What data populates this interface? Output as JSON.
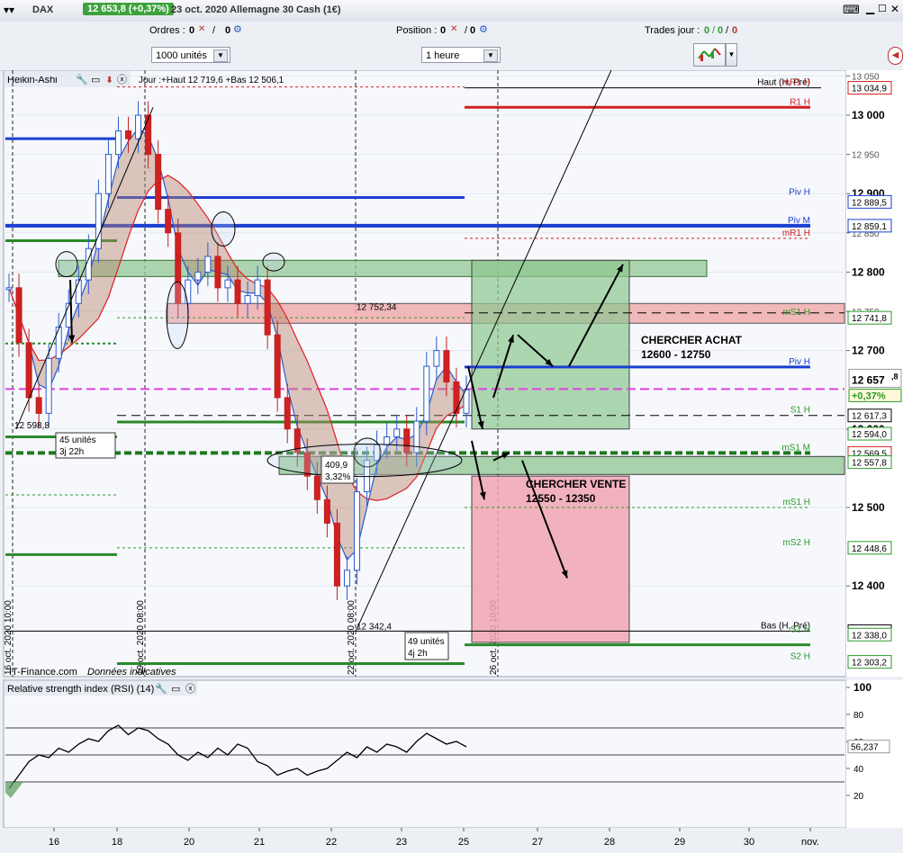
{
  "window": {
    "symbol": "DAX",
    "price_change": "12 653,8 (+0,37%)",
    "title": "23 oct. 2020 Allemagne 30 Cash (1€)"
  },
  "toolbar": {
    "orders_label": "Ordres :",
    "orders_a": "0",
    "orders_b": "0",
    "position_label": "Position :",
    "position_val": "0",
    "trades_label": "Trades jour :",
    "trades_green1": "0",
    "trades_green2": "0",
    "trades_red": "0",
    "units_select": "1000 unités",
    "period_select": "1 heure"
  },
  "price_panel": {
    "header_title": "Heikin-Ashi",
    "header_info": "Jour :+Haut 12 719,6 +Bas 12 506,1",
    "watermark": "IT-Finance.com",
    "watermark2": "Données indicatives",
    "right_labels": [
      {
        "text": "Haut (H, Pré)",
        "y": 13034.9,
        "color": "#000000"
      },
      {
        "text": "mR1 H",
        "y": 13034.9,
        "color": "#d02020"
      },
      {
        "text": "R1 H",
        "y": 13010,
        "color": "#d02020"
      },
      {
        "text": "Piv H",
        "y": 12895,
        "color": "#1a3fd0"
      },
      {
        "text": "Piv M",
        "y": 12859.1,
        "color": "#1a3fd0"
      },
      {
        "text": "mR1 H",
        "y": 12843,
        "color": "#d02020"
      },
      {
        "text": "mS1 H",
        "y": 12741.8,
        "color": "#2a9a2a"
      },
      {
        "text": "Piv H",
        "y": 12679,
        "color": "#1a3fd0"
      },
      {
        "text": "S1 H",
        "y": 12617.3,
        "color": "#2a9a2a"
      },
      {
        "text": "mS1 M",
        "y": 12569.5,
        "color": "#2a9a2a"
      },
      {
        "text": "mS1 H",
        "y": 12500,
        "color": "#2a9a2a"
      },
      {
        "text": "mS2 H",
        "y": 12448.6,
        "color": "#2a9a2a"
      },
      {
        "text": "Bas (H, Pré)",
        "y": 12342.4,
        "color": "#000000"
      },
      {
        "text": "S1 H",
        "y": 12338.0,
        "color": "#2a9a2a"
      },
      {
        "text": "S2 H",
        "y": 12303.2,
        "color": "#2a9a2a"
      }
    ],
    "annotations": {
      "low_left": "12 598,8",
      "units_left": "45 unités",
      "time_left": "3j 22h",
      "level_mid": "12 752,34",
      "range_box": "409,9",
      "range_pct": "3,32%",
      "low_mid": "12 342,4",
      "units_mid": "49 unités",
      "time_mid": "4j 2h",
      "buy_title": "CHERCHER ACHAT",
      "buy_range": "12600 -  12750",
      "sell_title": "CHERCHER  VENTE",
      "sell_range": "12550 - 12350"
    },
    "vertical_dates": [
      "16 oct. 2020 10:00",
      "19 oct. 2020 08:00",
      "22 oct. 2020 08:00",
      "26 oct. 2020 10:00"
    ]
  },
  "rsi_panel": {
    "title": "Relative strength index (RSI) (14)",
    "last_value": "56,237"
  },
  "x_axis_labels": [
    "16",
    "18",
    "20",
    "21",
    "22",
    "23",
    "25",
    "27",
    "28",
    "29",
    "30",
    "nov."
  ],
  "chart_data": [
    {
      "type": "line",
      "title": "DAX Heikin-Ashi 1 heure",
      "ylim": [
        12270,
        13050
      ],
      "y_ticks": [
        12400,
        12500,
        12600,
        12700,
        12750,
        12800,
        12850,
        12900,
        12950,
        13000,
        13050
      ],
      "y_tick_labels": [
        "12 400",
        "12 500",
        "12 600",
        "12 700",
        "12 750",
        "12 800",
        "12 850",
        "12 900",
        "12 950",
        "13 000",
        "13 050"
      ],
      "price_tags": [
        {
          "text": "13 034,9",
          "y": 13034.9,
          "color": "#d02020"
        },
        {
          "text": "12 889,5",
          "y": 12889.5,
          "color": "#1a3fd0"
        },
        {
          "text": "12 859,1",
          "y": 12859.1,
          "color": "#1a3fd0"
        },
        {
          "text": "12 741,8",
          "y": 12741.8,
          "color": "#2a9a2a"
        },
        {
          "text": "12 617,3",
          "y": 12617.3,
          "color": "#000000"
        },
        {
          "text": "12 594,0",
          "y": 12594.0,
          "color": "#2a9a2a"
        },
        {
          "text": "12 569,5",
          "y": 12569.5,
          "color": "#d02020"
        },
        {
          "text": "12 557,8",
          "y": 12557.8,
          "color": "#2a9a2a"
        },
        {
          "text": "12 448,6",
          "y": 12448.6,
          "color": "#2a9a2a"
        },
        {
          "text": "12 342,4",
          "y": 12342.4,
          "color": "#000000"
        },
        {
          "text": "12 338,0",
          "y": 12338.0,
          "color": "#2a9a2a"
        },
        {
          "text": "12 303,2",
          "y": 12303.2,
          "color": "#2a9a2a"
        }
      ],
      "current_price": {
        "main": "12 657",
        "decimal": ",8",
        "change": "+0,37%"
      },
      "series": [
        {
          "values": [
            12780,
            12710,
            12640,
            12620,
            12690,
            12730,
            12760,
            12790,
            12830,
            12900,
            12950,
            12980,
            12970,
            13000,
            12950,
            12880,
            12850,
            12760,
            12790,
            12800,
            12820,
            12780,
            12790,
            12760,
            12770,
            12790,
            12720,
            12640,
            12600,
            12570,
            12540,
            12510,
            12480,
            12400,
            12420,
            12520,
            12560,
            12580,
            12590,
            12600,
            12570,
            12610,
            12680,
            12700,
            12660,
            12620,
            12650
          ]
        }
      ]
    },
    {
      "type": "line",
      "title": "Relative strength index (RSI) (14)",
      "ylim": [
        0,
        100
      ],
      "y_ticks": [
        20,
        40,
        60,
        80,
        100
      ],
      "series": [
        {
          "values": [
            25,
            35,
            45,
            50,
            48,
            55,
            52,
            58,
            62,
            60,
            68,
            72,
            65,
            70,
            68,
            62,
            58,
            50,
            46,
            52,
            48,
            55,
            50,
            58,
            55,
            45,
            42,
            35,
            38,
            40,
            35,
            38,
            40,
            46,
            52,
            48,
            56,
            52,
            58,
            56,
            52,
            60,
            66,
            62,
            58,
            60,
            56
          ]
        }
      ]
    }
  ]
}
